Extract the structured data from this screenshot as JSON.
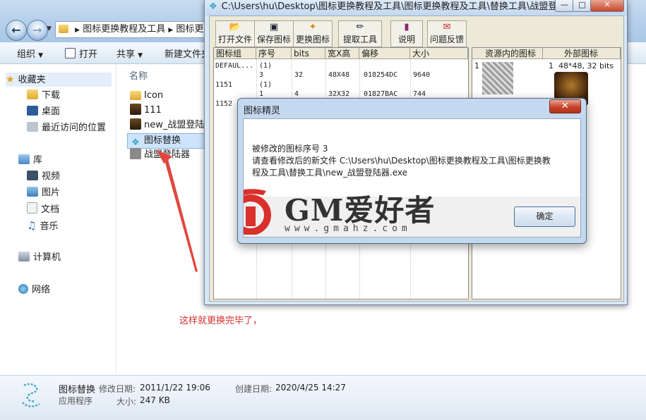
{
  "explorer": {
    "breadcrumb": [
      "图标更换教程及工具",
      "图标更"
    ],
    "toolbar": {
      "organize": "组织",
      "open": "打开",
      "share": "共享",
      "new_folder": "新建文件夹"
    },
    "sidebar": {
      "favorites": "收藏夹",
      "downloads": "下载",
      "desktop": "桌面",
      "recent": "最近访问的位置",
      "libraries": "库",
      "videos": "视频",
      "pictures": "图片",
      "documents": "文档",
      "music": "音乐",
      "computer": "计算机",
      "network": "网络"
    },
    "column_name": "名称",
    "files": [
      {
        "name": "Icon"
      },
      {
        "name": "111"
      },
      {
        "name": "new_战盟登陆器"
      },
      {
        "name": "图标替换"
      },
      {
        "name": "战盟登陆器"
      }
    ],
    "annotation": "这样就更换完毕了，",
    "details": {
      "name": "图标替换",
      "type": "应用程序",
      "modified_label": "修改日期:",
      "modified": "2011/1/22 19:06",
      "created_label": "创建日期:",
      "created": "2020/4/25 14:27",
      "size_label": "大小:",
      "size": "247 KB"
    }
  },
  "tool": {
    "title": "C:\\Users\\hu\\Desktop\\图标更换教程及工具\\图标更换教程及工具\\替换工具\\战盟登...",
    "buttons": {
      "open": "打开文件",
      "save": "保存图标",
      "replace": "更换图标",
      "extract": "提取工具",
      "help": "说明",
      "feedback": "问题反馈"
    },
    "columns": [
      "图标组",
      "序号",
      "bits",
      "宽X高",
      "偏移",
      "大小"
    ],
    "rows": [
      {
        "group": "DEFAUL...",
        "index": "(1)",
        "bits": "",
        "size_wh": "",
        "offset": "",
        "size": ""
      },
      {
        "group": "",
        "index": "3",
        "bits": "32",
        "size_wh": "48X48",
        "offset": "018254DC",
        "size": "9640"
      },
      {
        "group": "1151",
        "index": "(1)",
        "bits": "",
        "size_wh": "",
        "offset": "",
        "size": ""
      },
      {
        "group": "",
        "index": "1",
        "bits": "4",
        "size_wh": "32X32",
        "offset": "01827BAC",
        "size": "744"
      },
      {
        "group": "1152",
        "index": "",
        "bits": "",
        "size_wh": "",
        "offset": "",
        "size": ""
      }
    ],
    "right_pane": {
      "col_internal": "资源内的图标",
      "col_external": "外部图标",
      "internal_index": "1",
      "external_index": "1",
      "external_info": "48*48, 32 bits"
    }
  },
  "dialog": {
    "title": "图标精灵",
    "line1": "被修改的图标序号  3",
    "line2": "请查看修改后的新文件  C:\\Users\\hu\\Desktop\\图标更换教程及工具\\图标更换教",
    "line3": "程及工具\\替换工具\\new_战盟登陆器.exe",
    "ok": "确定"
  },
  "watermark": {
    "text": "GM爱好者",
    "url": "www.gmahz.com"
  },
  "colors": {
    "annotation": "#d9302c",
    "logo_red": "#d9302c",
    "arrow": "#e0473f"
  }
}
